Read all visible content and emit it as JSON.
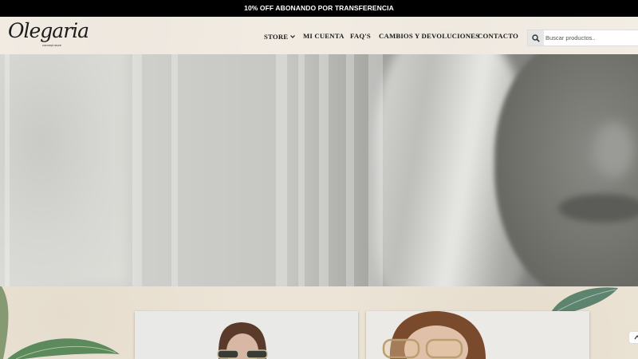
{
  "promo": {
    "text": "10% OFF ABONANDO POR TRANSFERENCIA"
  },
  "brand": {
    "name": "Olegaria",
    "tagline": "concept store"
  },
  "nav": {
    "items": [
      {
        "label": "STORE",
        "has_dropdown": true
      },
      {
        "label": "MI CUENTA"
      },
      {
        "label": "FAQ'S"
      },
      {
        "label": "CAMBIOS Y DEVOLUCIONES"
      },
      {
        "label": "CONTACTO"
      }
    ]
  },
  "search": {
    "placeholder": "Buscar productos..",
    "icon": "search-icon"
  },
  "colors": {
    "promo_bg": "#000000",
    "header_bg": "#f3ede4",
    "text": "#1a1a1a"
  },
  "hero": {
    "icon": "hero-banner-photo"
  },
  "products": [
    {
      "icon": "model-with-sunglasses-photo"
    },
    {
      "icon": "model-with-glasses-photo"
    }
  ]
}
